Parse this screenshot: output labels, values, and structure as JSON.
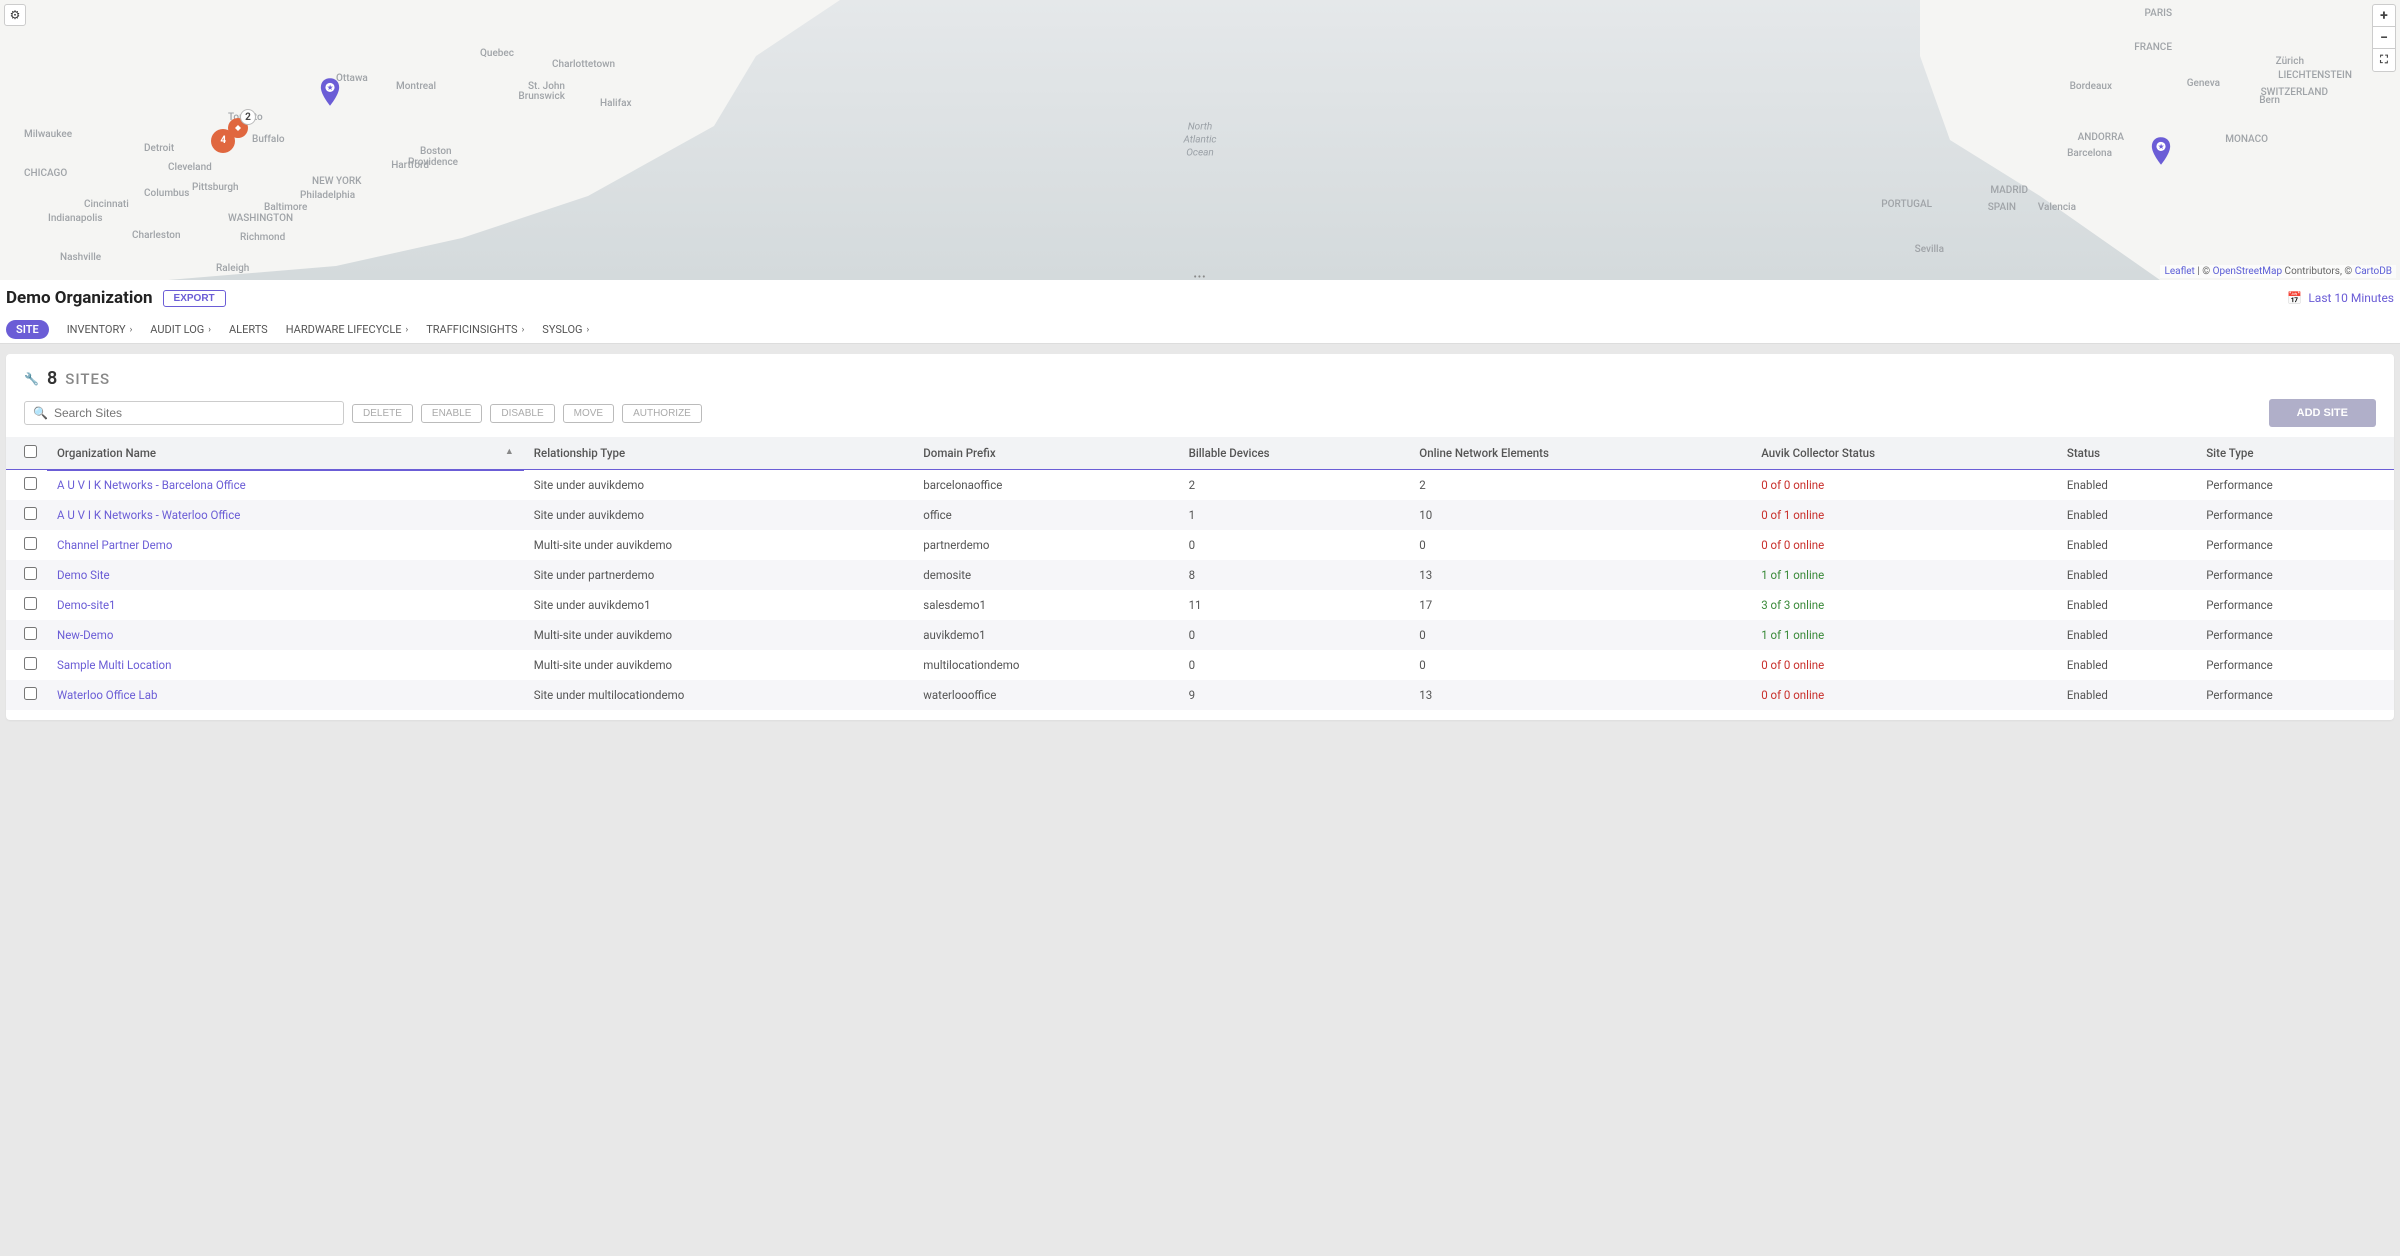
{
  "map": {
    "center_label_1": "North",
    "center_label_2": "Atlantic",
    "center_label_3": "Ocean",
    "attribution_leaflet": "Leaflet",
    "attribution_mid": " | © ",
    "attribution_osm": "OpenStreetMap",
    "attribution_tail": " Contributors, © ",
    "attribution_carto": "CartoDB",
    "labels": {
      "chicago": "CHICAGO",
      "detroit": "Detroit",
      "cleveland": "Cleveland",
      "indianapolis": "Indianapolis",
      "cincinnati": "Cincinnati",
      "milwaukee": "Milwaukee",
      "columbus": "Columbus",
      "washington": "WASHINGTON",
      "pittsburgh": "Pittsburgh",
      "newyork": "NEW YORK",
      "boston": "Boston",
      "philadelphia": "Philadelphia",
      "montreal": "Montreal",
      "ottawa": "Ottawa",
      "torento": "Toronto",
      "buffalo": "Buffalo",
      "quebec": "Quebec",
      "halifax": "Halifax",
      "charlottetown": "Charlottetown",
      "stjohn": "St. John",
      "nbrunswick": "Brunswick",
      "raleigh": "Raleigh",
      "nashville": "Nashville",
      "charleston": "Charleston",
      "hartfort": "Hartford",
      "richmond": "Richmond",
      "baltimore": "Baltimore",
      "providence": "Providence",
      "paris": "PARIS",
      "madrid": "MADRID",
      "barcelona": "Barcelona",
      "portugal": "PORTUGAL",
      "spain": "SPAIN",
      "france": "FRANCE",
      "swiss": "SWITZERLAND",
      "liecht": "LIECHTENSTEIN",
      "monaco": "MONACO",
      "valencia": "Valencia",
      "seville": "Sevilla",
      "andorra": "ANDORRA",
      "geneva": "Geneva",
      "bordeaux": "Bordeaux",
      "bern": "Bern",
      "zurich": "Zürich"
    },
    "cluster_a": "2",
    "cluster_b": "4"
  },
  "page": {
    "title": "Demo Organization",
    "export": "EXPORT"
  },
  "time_range": "Last 10 Minutes",
  "nav": {
    "site": "SITE",
    "inventory": "INVENTORY",
    "audit": "AUDIT LOG",
    "alerts": "ALERTS",
    "hardware": "HARDWARE LIFECYCLE",
    "traffic": "TRAFFICINSIGHTS",
    "syslog": "SYSLOG"
  },
  "panel": {
    "count": "8",
    "title": "SITES"
  },
  "toolbar": {
    "search_placeholder": "Search Sites",
    "delete": "DELETE",
    "enable": "ENABLE",
    "disable": "DISABLE",
    "move": "MOVE",
    "authorize": "AUTHORIZE",
    "add_site": "ADD SITE"
  },
  "columns": {
    "org": "Organization Name",
    "rel": "Relationship Type",
    "domain": "Domain Prefix",
    "billable": "Billable Devices",
    "online": "Online Network Elements",
    "collector": "Auvik Collector Status",
    "status": "Status",
    "type": "Site Type"
  },
  "rows": [
    {
      "org": "A U V I K Networks - Barcelona Office",
      "rel": "Site under auvikdemo",
      "domain": "barcelonaoffice",
      "billable": "2",
      "online": "2",
      "collector": "0 of 0 online",
      "collector_class": "status-red",
      "status": "Enabled",
      "type": "Performance"
    },
    {
      "org": "A U V I K Networks - Waterloo Office",
      "rel": "Site under auvikdemo",
      "domain": "office",
      "billable": "1",
      "online": "10",
      "collector": "0 of 1 online",
      "collector_class": "status-red",
      "status": "Enabled",
      "type": "Performance"
    },
    {
      "org": "Channel Partner Demo",
      "rel": "Multi-site under auvikdemo",
      "domain": "partnerdemo",
      "billable": "0",
      "online": "0",
      "collector": "0 of 0 online",
      "collector_class": "status-red",
      "status": "Enabled",
      "type": "Performance"
    },
    {
      "org": "Demo Site",
      "rel": "Site under partnerdemo",
      "domain": "demosite",
      "billable": "8",
      "online": "13",
      "collector": "1 of 1 online",
      "collector_class": "status-green",
      "status": "Enabled",
      "type": "Performance"
    },
    {
      "org": "Demo-site1",
      "rel": "Site under auvikdemo1",
      "domain": "salesdemo1",
      "billable": "11",
      "online": "17",
      "collector": "3 of 3 online",
      "collector_class": "status-green",
      "status": "Enabled",
      "type": "Performance"
    },
    {
      "org": "New-Demo",
      "rel": "Multi-site under auvikdemo",
      "domain": "auvikdemo1",
      "billable": "0",
      "online": "0",
      "collector": "1 of 1 online",
      "collector_class": "status-green",
      "status": "Enabled",
      "type": "Performance"
    },
    {
      "org": "Sample Multi Location",
      "rel": "Multi-site under auvikdemo",
      "domain": "multilocationdemo",
      "billable": "0",
      "online": "0",
      "collector": "0 of 0 online",
      "collector_class": "status-red",
      "status": "Enabled",
      "type": "Performance"
    },
    {
      "org": "Waterloo Office Lab",
      "rel": "Site under multilocationdemo",
      "domain": "waterloooffice",
      "billable": "9",
      "online": "13",
      "collector": "0 of 0 online",
      "collector_class": "status-red",
      "status": "Enabled",
      "type": "Performance"
    }
  ]
}
